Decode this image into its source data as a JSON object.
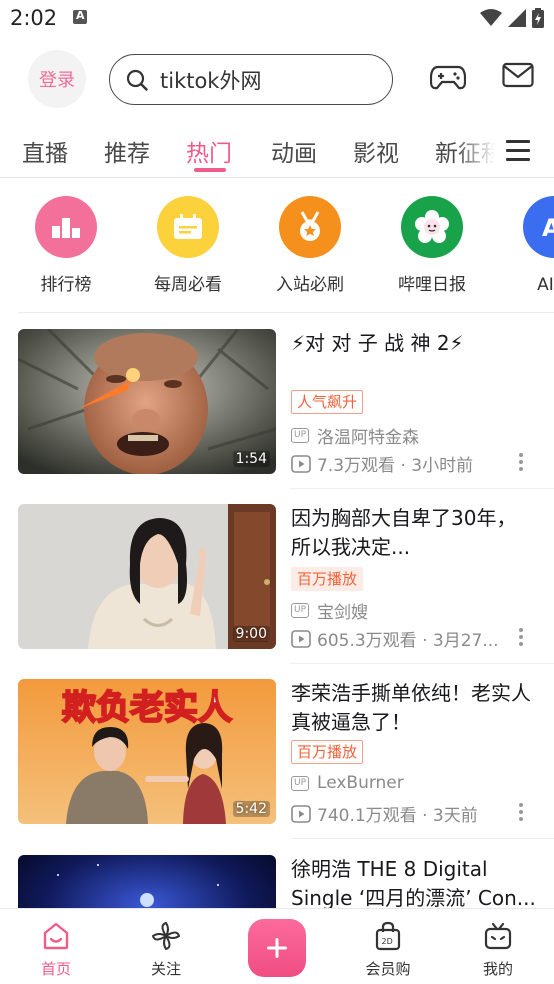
{
  "status_bar": {
    "time": "2:02"
  },
  "header": {
    "login_label": "登录",
    "search_text": "tiktok外网"
  },
  "tabs": [
    {
      "label": "直播"
    },
    {
      "label": "推荐"
    },
    {
      "label": "热门",
      "active": true
    },
    {
      "label": "动画"
    },
    {
      "label": "影视"
    },
    {
      "label": "新征程"
    }
  ],
  "quick_entries": [
    {
      "label": "排行榜",
      "color": "#f3709a",
      "icon": "ranking-icon"
    },
    {
      "label": "每周必看",
      "color": "#fbd13c",
      "icon": "calendar-icon"
    },
    {
      "label": "入站必刷",
      "color": "#f6901c",
      "icon": "medal-icon"
    },
    {
      "label": "哔哩日报",
      "color": "#18a34a",
      "icon": "flower-icon"
    },
    {
      "label": "AI新",
      "color": "#3b6df0",
      "icon": "ai-icon"
    }
  ],
  "videos": [
    {
      "title": "⚡对 对 子 战 神 2⚡",
      "badge": "人气飙升",
      "uploader": "洛温阿特金森",
      "stats": "7.3万观看 · 3小时前",
      "duration": "1:54"
    },
    {
      "title": "因为胸部大自卑了30年，所以我决定...",
      "badge": "百万播放",
      "uploader": "宝剑嫂",
      "stats": "605.3万观看 · 3月27...",
      "duration": "9:00"
    },
    {
      "title": "李荣浩手撕单依纯！老实人真被逼急了！",
      "badge": "百万播放",
      "uploader": "LexBurner",
      "stats": "740.1万观看 · 3天前",
      "duration": "5:42",
      "thumb_caption": "欺负老实人"
    },
    {
      "title": "徐明浩 THE 8 Digital Single ‘四月的漂流’ Con..."
    }
  ],
  "bottom_nav": [
    {
      "label": "首页",
      "active": true
    },
    {
      "label": "关注"
    },
    {
      "label": "会员购"
    },
    {
      "label": "我的"
    }
  ],
  "colors": {
    "accent": "#f05c8a",
    "badge": "#f0643c"
  }
}
